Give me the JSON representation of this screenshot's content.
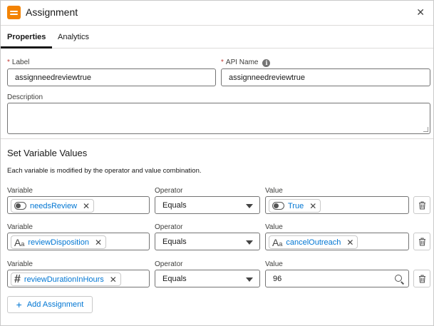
{
  "header": {
    "title": "Assignment",
    "close": "✕"
  },
  "tabs": [
    {
      "label": "Properties",
      "active": true
    },
    {
      "label": "Analytics",
      "active": false
    }
  ],
  "form": {
    "label": {
      "label": "Label",
      "value": "assignneedreviewtrue"
    },
    "api_name": {
      "label": "API Name",
      "value": "assignneedreviewtrue"
    },
    "description": {
      "label": "Description",
      "value": ""
    }
  },
  "section": {
    "title": "Set Variable Values",
    "description": "Each variable is modified by the operator and value combination."
  },
  "rows": [
    {
      "variable_label": "Variable",
      "operator_label": "Operator",
      "value_label": "Value",
      "variable": "needsReview",
      "variable_icon": "toggle-icon",
      "operator": "Equals",
      "value": "True",
      "value_icon": "toggle-icon"
    },
    {
      "variable_label": "Variable",
      "operator_label": "Operator",
      "value_label": "Value",
      "variable": "reviewDisposition",
      "variable_icon": "text-type-icon",
      "operator": "Equals",
      "value": "cancelOutreach",
      "value_icon": "text-type-icon"
    },
    {
      "variable_label": "Variable",
      "operator_label": "Operator",
      "value_label": "Value",
      "variable": "reviewDurationInHours",
      "variable_icon": "number-hash-icon",
      "operator": "Equals",
      "value": "96",
      "value_icon": "search-icon"
    }
  ],
  "add_button": "Add Assignment",
  "colors": {
    "accent": "#0176d3",
    "app_icon": "#f38303",
    "required": "#c23934"
  }
}
